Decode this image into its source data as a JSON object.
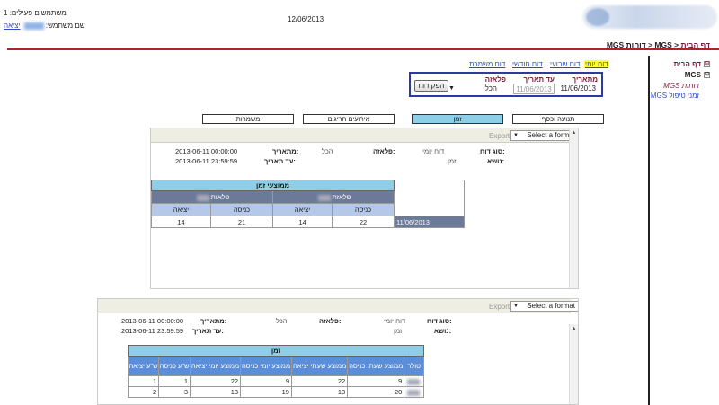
{
  "header": {
    "active_users_label": "משתמשים פעילים:",
    "active_users_count": "1",
    "username_label": "שם משתמש:",
    "logout_label": "יציאה",
    "date": "12/06/2013"
  },
  "breadcrumb": {
    "home": "דף הבית",
    "sep1": ">",
    "mgs": "MGS",
    "sep2": ">",
    "current": "MGS דוחות"
  },
  "sidebar": {
    "items": [
      {
        "label": "דף הבית",
        "toggle": "⊟"
      },
      {
        "label": "MGS",
        "toggle": "⊟"
      },
      {
        "label": "MGS דוחות"
      },
      {
        "label": "MGS זמני טיפול"
      }
    ]
  },
  "report_links": {
    "daily": "דוח יומי",
    "weekly": "דוח שבועי",
    "monthly": "דוח חודשי",
    "shift": "דוח משמרת"
  },
  "filter": {
    "from_label": "מתאריך",
    "to_label": "עד תאריך",
    "station_label": "פלאזה",
    "from_value": "11/06/2013",
    "to_value": "11/06/2013",
    "station_value": "הכל",
    "produce_button": "הפק דוח"
  },
  "tabs": [
    {
      "label": "תנועה וכסף"
    },
    {
      "label": "זמן",
      "active": true
    },
    {
      "label": "אירועים חריגים"
    },
    {
      "label": "משמרות"
    }
  ],
  "report1": {
    "export_label": "Export",
    "format_placeholder": "Select a format",
    "report_type_label": "סוג דוח:",
    "report_type_value": "דוח יומי",
    "subject_label": "נושא:",
    "subject_value": "זמן",
    "station_label": "פלאזה:",
    "station_value": "הכל",
    "from_label": "מתאריך:",
    "from_value": "2013-06-11 00:00:00",
    "to_label": "עד תאריך:",
    "to_value": "2013-06-11 23:59:59",
    "table_title": "ממוצעי זמן",
    "group1": "פלאזת",
    "group2": "פלאזת",
    "col_entry": "כניסה",
    "col_exit": "יציאה",
    "row_date": "11/06/2013",
    "values": [
      "22",
      "14",
      "21",
      "14"
    ]
  },
  "report2": {
    "export_label": "Export",
    "format_placeholder": "Select a format",
    "report_type_label": "סוג דוח:",
    "report_type_value": "דוח יומי",
    "subject_label": "נושא:",
    "subject_value": "זמן",
    "station_label": "פלאזה:",
    "station_value": "הכל",
    "from_label": "מתאריך:",
    "from_value": "2013-06-11 00:00:00",
    "to_label": "עד תאריך:",
    "to_value": "2013-06-11 23:59:59",
    "table_title": "זמן",
    "columns": [
      "טולר",
      "ממוצע שעתי כניסה",
      "ממוצע שעתי יציאה",
      "ממוצע יומי כניסה",
      "ממוצע יומי יציאה",
      "ש\"ע כניסה",
      "ש\"ע יציאה"
    ],
    "rows": [
      [
        "9",
        "22",
        "9",
        "22",
        "1",
        "1"
      ],
      [
        "20",
        "13",
        "19",
        "13",
        "3",
        "2"
      ]
    ]
  }
}
